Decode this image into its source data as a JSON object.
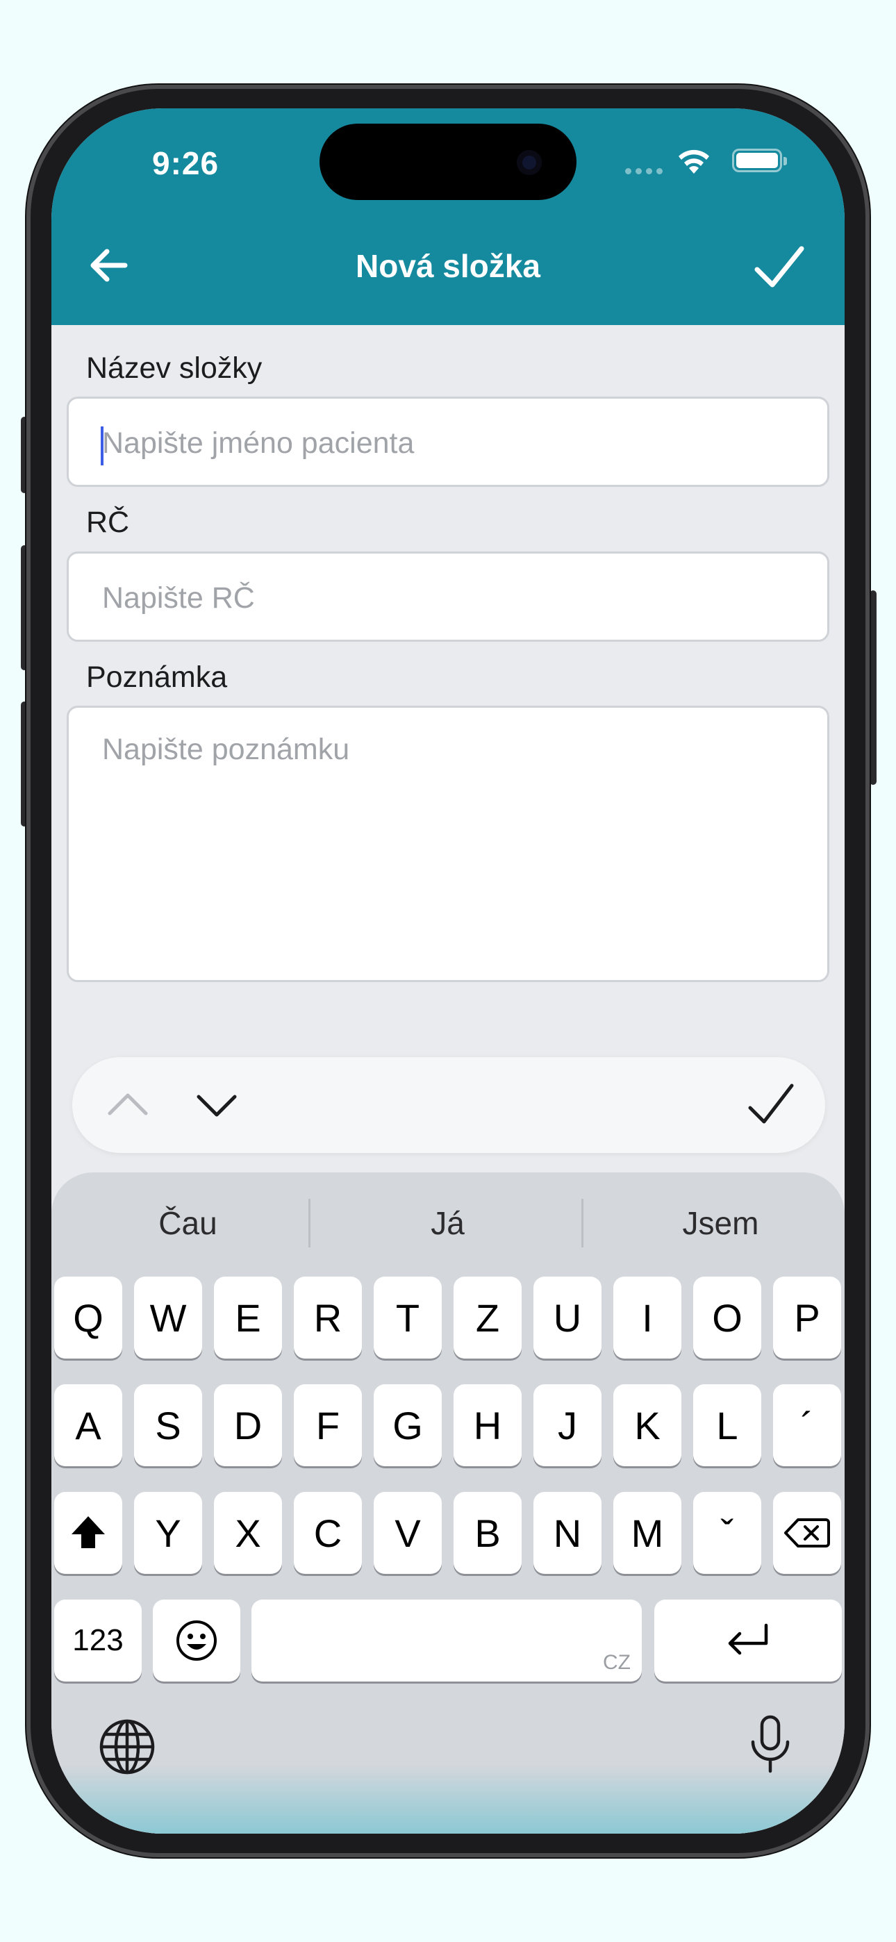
{
  "status_bar": {
    "time": "9:26"
  },
  "nav": {
    "title": "Nová složka",
    "back_icon": "arrow-left-icon",
    "confirm_icon": "checkmark-icon"
  },
  "form": {
    "name_label": "Název složky",
    "name_placeholder": "Napište jméno pacienta",
    "rc_label": "RČ",
    "rc_placeholder": "Napište RČ",
    "note_label": "Poznámka",
    "note_placeholder": "Napište poznámku"
  },
  "accessory": {
    "prev_icon": "chevron-up-icon",
    "next_icon": "chevron-down-icon",
    "done_icon": "checkmark-icon"
  },
  "keyboard": {
    "suggestions": [
      "Čau",
      "Já",
      "Jsem"
    ],
    "row1": [
      "Q",
      "W",
      "E",
      "R",
      "T",
      "Z",
      "U",
      "I",
      "O",
      "P"
    ],
    "row2": [
      "A",
      "S",
      "D",
      "F",
      "G",
      "H",
      "J",
      "K",
      "L",
      "´"
    ],
    "row3": [
      "Y",
      "X",
      "C",
      "V",
      "B",
      "N",
      "M",
      "ˇ"
    ],
    "numbers_key": "123",
    "space_lang": "CZ",
    "colors": {
      "header": "#158a9e",
      "caret": "#3c5de6"
    }
  }
}
